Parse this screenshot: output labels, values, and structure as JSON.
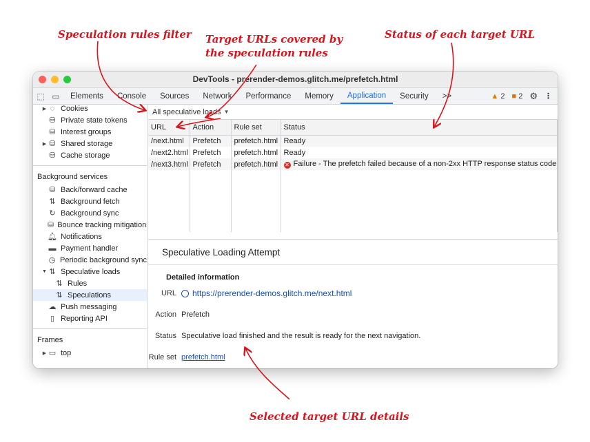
{
  "callouts": {
    "filter": "Speculation rules filter",
    "targets_line1": "Target URLs covered by",
    "targets_line2": "the speculation rules",
    "status": "Status of each target URL",
    "details": "Selected target URL details"
  },
  "window": {
    "title": "DevTools - prerender-demos.glitch.me/prefetch.html"
  },
  "tabs": [
    {
      "label": "Elements"
    },
    {
      "label": "Console"
    },
    {
      "label": "Sources"
    },
    {
      "label": "Network"
    },
    {
      "label": "Performance"
    },
    {
      "label": "Memory"
    },
    {
      "label": "Application"
    },
    {
      "label": "Security"
    },
    {
      "label": ">>"
    }
  ],
  "toolbar": {
    "warnings": "2",
    "issues": "2"
  },
  "sidebar": {
    "storage_items": [
      {
        "label": "Cookies"
      },
      {
        "label": "Private state tokens"
      },
      {
        "label": "Interest groups"
      },
      {
        "label": "Shared storage"
      },
      {
        "label": "Cache storage"
      }
    ],
    "background_header": "Background services",
    "background_items": [
      {
        "label": "Back/forward cache"
      },
      {
        "label": "Background fetch"
      },
      {
        "label": "Background sync"
      },
      {
        "label": "Bounce tracking mitigations"
      },
      {
        "label": "Notifications"
      },
      {
        "label": "Payment handler"
      },
      {
        "label": "Periodic background sync"
      },
      {
        "label": "Speculative loads"
      },
      {
        "label": "Rules"
      },
      {
        "label": "Speculations"
      },
      {
        "label": "Push messaging"
      },
      {
        "label": "Reporting API"
      }
    ],
    "frames_header": "Frames",
    "frames_items": [
      {
        "label": "top"
      }
    ]
  },
  "filter": {
    "label": "All speculative loads"
  },
  "table": {
    "headers": [
      "URL",
      "Action",
      "Rule set",
      "Status"
    ],
    "rows": [
      {
        "url": "/next.html",
        "action": "Prefetch",
        "rule_set": "prefetch.html",
        "status": "Ready"
      },
      {
        "url": "/next2.html",
        "action": "Prefetch",
        "rule_set": "prefetch.html",
        "status": "Ready"
      },
      {
        "url": "/next3.html",
        "action": "Prefetch",
        "rule_set": "prefetch.html",
        "status": "Failure - The prefetch failed because of a non-2xx HTTP response status code."
      }
    ]
  },
  "detail": {
    "title": "Speculative Loading Attempt",
    "section": "Detailed information",
    "url_label": "URL",
    "url_value": "https://prerender-demos.glitch.me/next.html",
    "action_label": "Action",
    "action_value": "Prefetch",
    "status_label": "Status",
    "status_value": "Speculative load finished and the result is ready for the next navigation.",
    "ruleset_label": "Rule set",
    "ruleset_value": "prefetch.html"
  }
}
